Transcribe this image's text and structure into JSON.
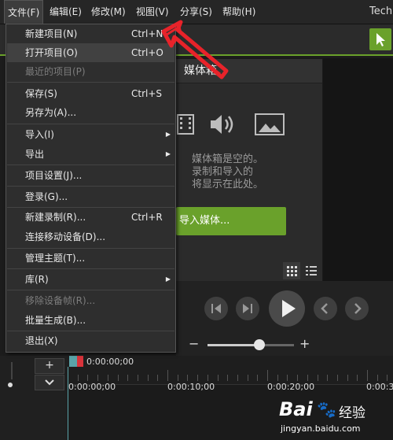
{
  "menubar": {
    "items": [
      "文件(F)",
      "编辑(E)",
      "修改(M)",
      "视图(V)",
      "分享(S)",
      "帮助(H)"
    ],
    "app_title": "Tech"
  },
  "file_menu": {
    "items": [
      {
        "label": "新建项目(N)",
        "shortcut": "Ctrl+N"
      },
      {
        "label": "打开项目(O)",
        "shortcut": "Ctrl+O"
      },
      {
        "label": "最近的项目(P)",
        "shortcut": ""
      },
      {
        "label": "保存(S)",
        "shortcut": "Ctrl+S"
      },
      {
        "label": "另存为(A)...",
        "shortcut": ""
      },
      {
        "label": "导入(I)",
        "shortcut": ""
      },
      {
        "label": "导出",
        "shortcut": ""
      },
      {
        "label": "项目设置(J)...",
        "shortcut": ""
      },
      {
        "label": "登录(G)...",
        "shortcut": ""
      },
      {
        "label": "新建录制(R)...",
        "shortcut": "Ctrl+R"
      },
      {
        "label": "连接移动设备(D)...",
        "shortcut": ""
      },
      {
        "label": "管理主题(T)...",
        "shortcut": ""
      },
      {
        "label": "库(R)",
        "shortcut": ""
      },
      {
        "label": "移除设备帧(R)...",
        "shortcut": ""
      },
      {
        "label": "批量生成(B)...",
        "shortcut": ""
      },
      {
        "label": "退出(X)",
        "shortcut": ""
      }
    ]
  },
  "media_bin": {
    "title": "媒体箱",
    "empty_lines": [
      "媒体箱是空的。",
      "录制和导入的",
      "将显示在此处。"
    ],
    "import_button": "导入媒体..."
  },
  "zoom": {
    "minus": "−",
    "plus": "+",
    "level": 0.6
  },
  "timeline": {
    "playhead_time": "0:00:00;00",
    "ticks": [
      "0:00:00;00",
      "0:00:10;00",
      "0:00:20;00",
      "0:00:3"
    ],
    "add_track": "+",
    "collapse": "⌄"
  },
  "watermark": {
    "brand": "Bai",
    "brand2": "经验",
    "url": "jingyan.baidu.com"
  },
  "colors": {
    "accent": "#6aa12b",
    "arrow": "#e8232a"
  }
}
